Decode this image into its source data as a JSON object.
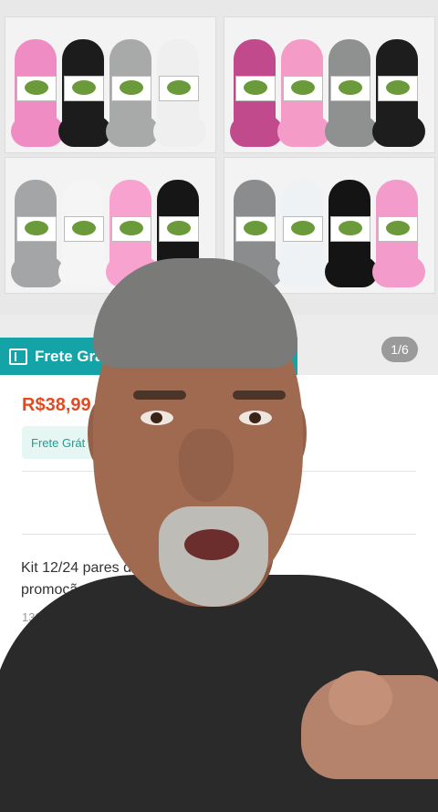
{
  "gallery": {
    "photos": [
      {
        "socks": [
          "#f08cc4",
          "#1c1c1c",
          "#a7aaa8",
          "#efefef"
        ]
      },
      {
        "socks": [
          "#c04a8c",
          "#f59bc7",
          "#8f9190",
          "#1d1d1d"
        ]
      },
      {
        "socks": [
          "#a4a5a6",
          "#f5f5f5",
          "#f7a2cf",
          "#161616"
        ]
      },
      {
        "socks": [
          "#8a8c8e",
          "#eff2f5",
          "#141414",
          "#f39ccb"
        ]
      }
    ]
  },
  "banner": {
    "label": "Frete Grá",
    "icon": "coupon-icon"
  },
  "counter": "1/6",
  "product": {
    "price": "R$38,99",
    "chip": "Frete Grát",
    "title_line1": "Kit 12/24 pares de                    curto feminina",
    "title_line2": "promoção 36-40",
    "sold": "139 V"
  },
  "colors": {
    "accent": "#14a3a6",
    "price": "#e14b22"
  }
}
